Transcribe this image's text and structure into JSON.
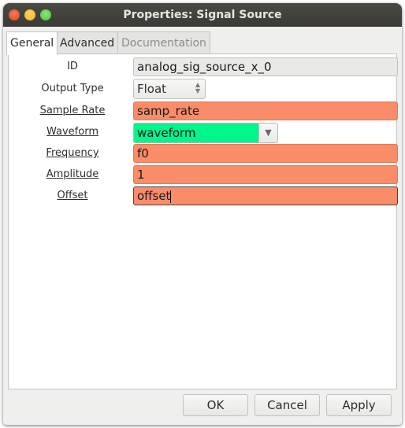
{
  "window": {
    "title": "Properties: Signal Source"
  },
  "tabs": [
    {
      "label": "General",
      "state": "active"
    },
    {
      "label": "Advanced",
      "state": "normal"
    },
    {
      "label": "Documentation",
      "state": "disabled"
    }
  ],
  "fields": {
    "id": {
      "label": "ID",
      "value": "analog_sig_source_x_0"
    },
    "output_type": {
      "label": "Output Type",
      "value": "Float"
    },
    "sample_rate": {
      "label": "Sample Rate",
      "value": "samp_rate"
    },
    "waveform": {
      "label": "Waveform",
      "value": "waveform"
    },
    "frequency": {
      "label": "Frequency",
      "value": "f0"
    },
    "amplitude": {
      "label": "Amplitude",
      "value": "1"
    },
    "offset": {
      "label": "Offset",
      "value": "offset"
    }
  },
  "buttons": {
    "ok": "OK",
    "cancel": "Cancel",
    "apply": "Apply"
  },
  "colors": {
    "param_highlight": "#fa8c6a",
    "waveform_highlight": "#00f58b"
  }
}
